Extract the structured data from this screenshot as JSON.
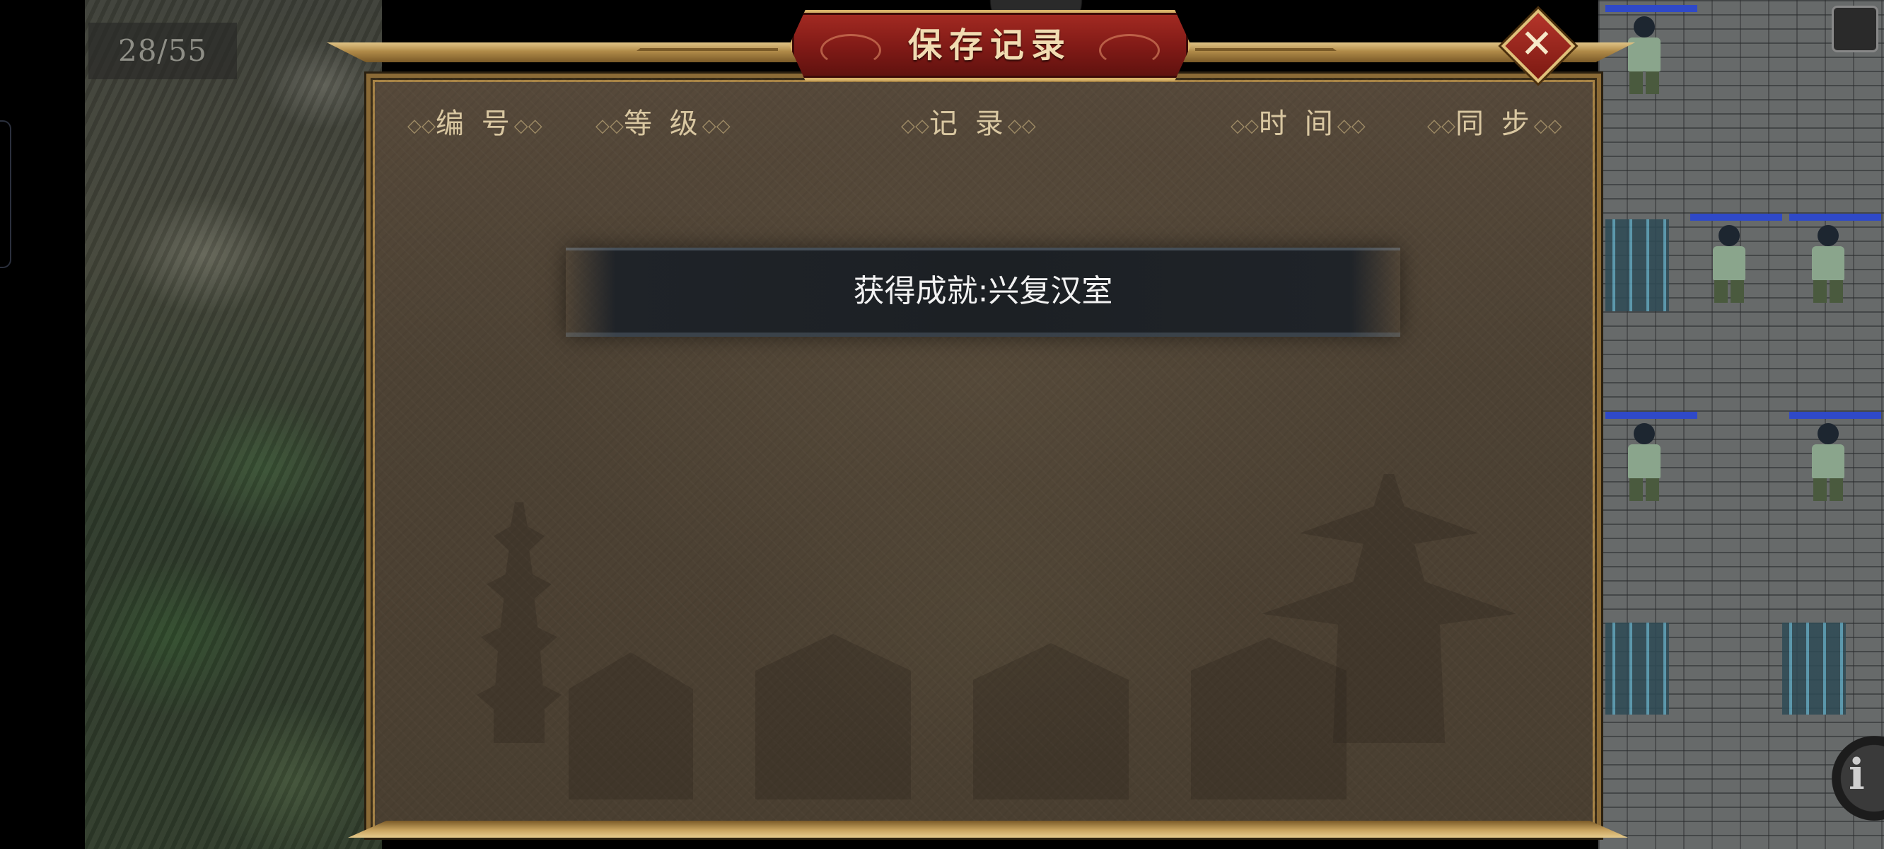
{
  "hud": {
    "counter": "28/55"
  },
  "dialog": {
    "title": "保存记录",
    "close_symbol": "✕",
    "columns": [
      {
        "label": "编 号"
      },
      {
        "label": "等 级"
      },
      {
        "label": "记 录"
      },
      {
        "label": "时 间"
      },
      {
        "label": "同 步"
      }
    ],
    "header_ornament_left": "◇◇",
    "header_ornament_right": "◇◇"
  },
  "toast": {
    "message": "获得成就:兴复汉室"
  },
  "corner_button": {
    "glyph": "i"
  },
  "icons": {
    "close": "close-icon",
    "info": "info-icon",
    "menu": "menu-icon"
  },
  "colors": {
    "title_plaque": "#8a1f19",
    "frame_gold": "#c8a35f",
    "panel_bg": "#4d4234",
    "hp_bar": "#2f49c8"
  }
}
